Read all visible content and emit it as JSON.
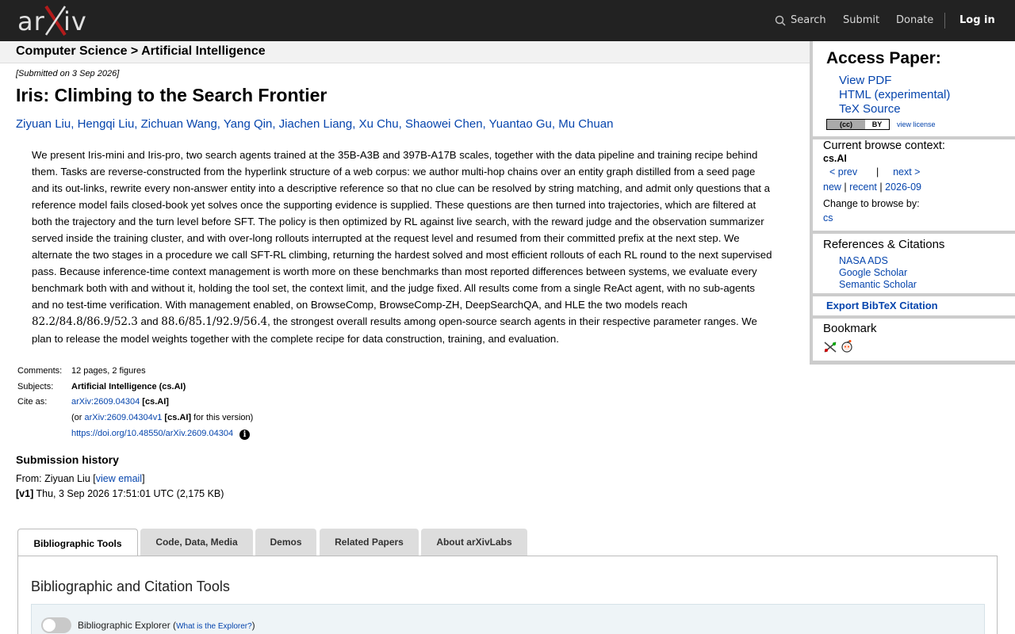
{
  "topbar": {
    "logo_a": "ar",
    "logo_x": "X",
    "logo_iv": "iv",
    "search": "Search",
    "submit": "Submit",
    "donate": "Donate",
    "login": "Log in"
  },
  "breadcrumb": "Computer Science > Artificial Intelligence",
  "paper": {
    "submitted": "[Submitted on 3 Sep 2026]",
    "title": "Iris: Climbing to the Search Frontier",
    "authors": [
      "Ziyuan Liu",
      "Hengqi Liu",
      "Zichuan Wang",
      "Yang Qin",
      "Jiachen Liang",
      "Xu Chu",
      "Shaowei Chen",
      "Yuantao Gu",
      "Mu Chuan"
    ],
    "abstract_part1": "We present Iris-mini and Iris-pro, two search agents trained at the 35B-A3B and 397B-A17B scales, together with the data pipeline and training recipe behind them. Tasks are reverse-constructed from the hyperlink structure of a web corpus: we author multi-hop chains over an entity graph distilled from a seed page and its out-links, rewrite every non-answer entity into a descriptive reference so that no clue can be resolved by string matching, and admit only questions that a reference model fails closed-book yet solves once the supporting evidence is supplied. These questions are then turned into trajectories, which are filtered at both the trajectory and the turn level before SFT. The policy is then optimized by RL against live search, with the reward judge and the observation summarizer served inside the training cluster, and with over-long rollouts interrupted at the request level and resumed from their committed prefix at the next step. We alternate the two stages in a procedure we call SFT-RL climbing, returning the hardest solved and most efficient rollouts of each RL round to the next supervised pass. Because inference-time context management is worth more on these benchmarks than most reported differences between systems, we evaluate every benchmark both with and without it, holding the tool set, the context limit, and the judge fixed. All results come from a single ReAct agent, with no sub-agents and no test-time verification. With management enabled, on BrowseComp, BrowseComp-ZH, DeepSearchQA, and HLE the two models reach ",
    "math1": "82.2/84.8/86.9/52.3",
    "abstract_and": " and ",
    "math2": "88.6/85.1/92.9/56.4",
    "abstract_part2": ", the strongest overall results among open-source search agents in their respective parameter ranges. We plan to release the model weights together with the complete recipe for data construction, training, and evaluation."
  },
  "meta": {
    "comments_label": "Comments:",
    "comments": "12 pages, 2 figures",
    "subjects_label": "Subjects:",
    "subjects": "Artificial Intelligence (cs.AI)",
    "cite_label": "Cite as:",
    "cite_id": "arXiv:2609.04304",
    "cite_cat": "[cs.AI]",
    "or_open": "(or ",
    "cite_v1": "arXiv:2609.04304v1",
    "cite_v1_cat": "[cs.AI]",
    "for_version": " for this version)",
    "doi": "https://doi.org/10.48550/arXiv.2609.04304"
  },
  "history": {
    "title": "Submission history",
    "from_prefix": "From: Ziyuan Liu [",
    "view_email": "view email",
    "from_suffix": "]",
    "v1_label": "[v1]",
    "v1_text": " Thu, 3 Sep 2026 17:51:01 UTC (2,175 KB)"
  },
  "tabs": [
    "Bibliographic Tools",
    "Code, Data, Media",
    "Demos",
    "Related Papers",
    "About arXivLabs"
  ],
  "panel": {
    "title": "Bibliographic and Citation Tools",
    "explorer_label": "Bibliographic Explorer (",
    "explorer_link": "What is the Explorer?",
    "explorer_close": ")"
  },
  "sidebar": {
    "access_title": "Access Paper:",
    "access_links": [
      "View PDF",
      "HTML (experimental)",
      "TeX Source"
    ],
    "cc_left": "(cc)",
    "cc_right": "BY",
    "view_license": "view license",
    "browse_title": "Current browse context:",
    "browse_ctx": "cs.AI",
    "prev": "< prev",
    "nav_sep": "|",
    "next": "next >",
    "new": "new",
    "recent": "recent",
    "month": "2026-09",
    "change_browse": "Change to browse by:",
    "cs": "cs",
    "refs_title": "References & Citations",
    "refs": [
      "NASA ADS",
      "Google Scholar",
      "Semantic Scholar"
    ],
    "export": "Export BibTeX Citation",
    "bookmark_title": "Bookmark"
  }
}
